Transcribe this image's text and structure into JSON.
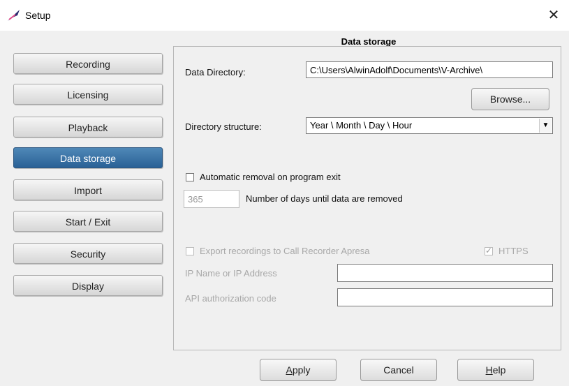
{
  "window": {
    "title": "Setup",
    "close_glyph": "✕",
    "icon": "app-feather-icon"
  },
  "sidebar": {
    "items": [
      {
        "label": "Recording",
        "active": false
      },
      {
        "label": "Licensing",
        "active": false
      },
      {
        "label": "Playback",
        "active": false
      },
      {
        "label": "Data storage",
        "active": true
      },
      {
        "label": "Import",
        "active": false
      },
      {
        "label": "Start / Exit",
        "active": false
      },
      {
        "label": "Security",
        "active": false
      },
      {
        "label": "Display",
        "active": false
      }
    ]
  },
  "panel": {
    "title": "Data storage",
    "data_directory": {
      "label": "Data Directory:",
      "value": "C:\\Users\\AlwinAdolf\\Documents\\V-Archive\\"
    },
    "browse_label": "Browse...",
    "directory_structure": {
      "label": "Directory structure:",
      "value": "Year \\ Month \\ Day \\ Hour"
    },
    "auto_removal": {
      "label": "Automatic removal on program exit",
      "checked": false
    },
    "days": {
      "value": "365",
      "label": "Number of days until data are removed"
    },
    "export": {
      "label": "Export recordings to Call Recorder Apresa",
      "checked": false,
      "enabled": false
    },
    "https": {
      "label": "HTTPS",
      "checked": true,
      "enabled": false
    },
    "ip_name": {
      "label": "IP Name or IP Address",
      "value": ""
    },
    "api_code": {
      "label": "API authorization code",
      "value": ""
    }
  },
  "footer": {
    "apply_mnemonic": "A",
    "apply_rest": "pply",
    "cancel_label": "Cancel",
    "help_mnemonic": "H",
    "help_rest": "elp"
  },
  "colors": {
    "active_nav": "#3a74a7",
    "disabled_text": "#a8a8a8",
    "dialog_bg": "#f0f0f0"
  }
}
